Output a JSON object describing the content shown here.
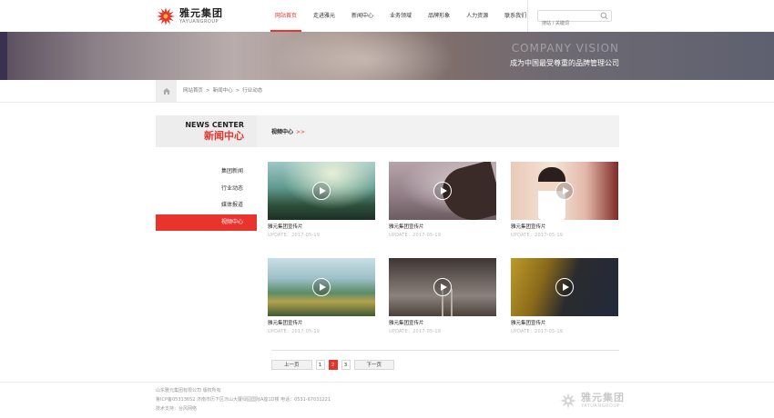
{
  "brand": {
    "name_cn": "雅元集团",
    "name_en": "YAYUANGROUP",
    "accent_color": "#e8342c"
  },
  "nav": {
    "items": [
      {
        "label": "网站首页",
        "active": true
      },
      {
        "label": "走进雅元",
        "active": false
      },
      {
        "label": "新闻中心",
        "active": false
      },
      {
        "label": "业务领域",
        "active": false
      },
      {
        "label": "品牌形象",
        "active": false
      },
      {
        "label": "人力资源",
        "active": false
      },
      {
        "label": "联系我们",
        "active": false
      }
    ],
    "search_placeholder": "搜站 / 关键词"
  },
  "banner": {
    "title_en": "COMPANY VISION",
    "title_cn": "成为中国最受尊重的品牌管理公司"
  },
  "breadcrumb": {
    "home_icon": "home-icon",
    "items": [
      "网站首页",
      ">",
      "新闻中心",
      ">",
      "行业动态"
    ]
  },
  "sidebar": {
    "title_en": "NEWS CENTER",
    "title_cn": "新闻中心",
    "items": [
      {
        "label": "集团新闻",
        "active": false
      },
      {
        "label": "行业动态",
        "active": false
      },
      {
        "label": "媒体报道",
        "active": false
      },
      {
        "label": "视频中心",
        "active": true
      }
    ]
  },
  "main": {
    "section_title": "视频中心",
    "section_arrow": ">>",
    "videos": [
      {
        "title": "雅元集团宣传片",
        "date": "UPDATE：2017-05-19"
      },
      {
        "title": "雅元集团宣传片",
        "date": "UPDATE：2017-05-19"
      },
      {
        "title": "雅元集团宣传片",
        "date": "UPDATE：2017-05-19"
      },
      {
        "title": "雅元集团宣传片",
        "date": "UPDATE：2017-05-19"
      },
      {
        "title": "雅元集团宣传片",
        "date": "UPDATE：2017-05-19"
      },
      {
        "title": "雅元集团宣传片",
        "date": "UPDATE：2017-05-19"
      }
    ]
  },
  "pager": {
    "prev": "上一页",
    "pages": [
      "1",
      "2",
      "3"
    ],
    "current": "2",
    "next": "下一页"
  },
  "footer": {
    "lines": [
      "山东雅元集团有限公司  版权所有",
      "鲁ICP备05313652   济南市历下区泺山大厦绿园国际A座1D楼  电话：0531-67031221",
      "技术支持：台风网络"
    ],
    "logo_cn": "雅元集团",
    "logo_en": "YAYUANGROUP"
  }
}
